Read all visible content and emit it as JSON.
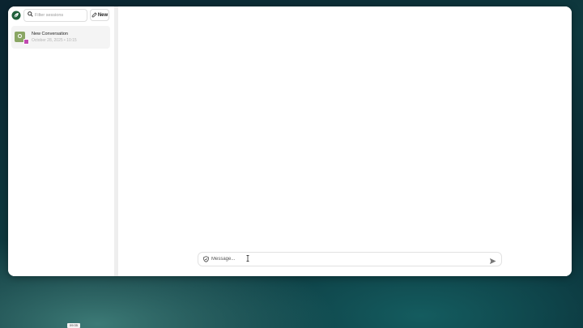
{
  "sidebar": {
    "logo_icon": "leaf-logo-icon",
    "search": {
      "placeholder": "Filter sessions",
      "value": ""
    },
    "new_button": {
      "label": "New",
      "icon": "pencil-icon"
    },
    "sessions": [
      {
        "title": "New Conversation",
        "meta": "October 28, 2025 • 10:15",
        "avatar_letter": "O",
        "avatar_color": "#8aa664",
        "badge_color": "#c04ab0"
      }
    ]
  },
  "composer": {
    "placeholder": "Message...",
    "value": "",
    "left_icon": "shield-icon",
    "send_icon": "send-icon"
  },
  "taskbar": {
    "label": "09:35"
  },
  "colors": {
    "accent": "#1f5f3a",
    "window_bg": "#ffffff",
    "divider": "#eeeeee"
  }
}
